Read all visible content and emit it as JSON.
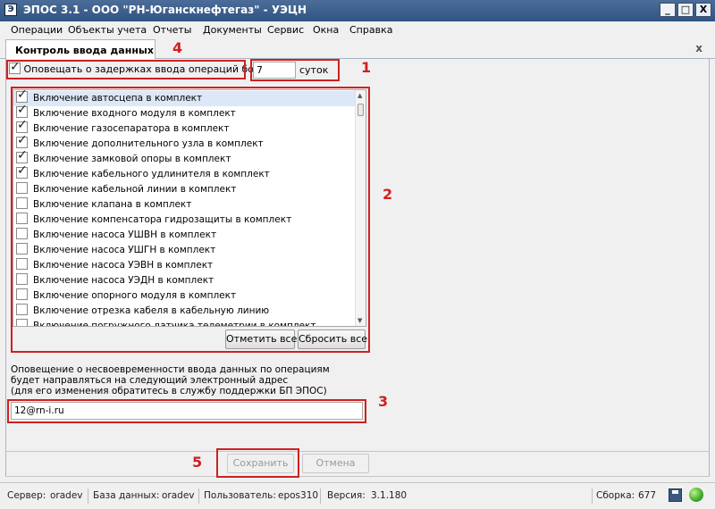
{
  "window": {
    "app_icon_glyph": "Э",
    "title": "ЭПОС 3.1 - ООО \"РН-Юганскнефтегаз\" - УЭЦН",
    "minimize": "_",
    "maximize": "□",
    "close": "X"
  },
  "menu": [
    "Операции",
    "Объекты учета",
    "Отчеты",
    "Документы",
    "Сервис",
    "Окна",
    "Справка"
  ],
  "tab": {
    "label": "Контроль ввода данных",
    "close": "x"
  },
  "notify": {
    "checked": true,
    "label": "Оповещать о задержках ввода операций более",
    "days_value": "7",
    "days_unit": "суток"
  },
  "operations": [
    {
      "label": "Включение автосцепа в комплект",
      "checked": true,
      "selected": true
    },
    {
      "label": "Включение входного модуля в комплект",
      "checked": true
    },
    {
      "label": "Включение газосепаратора в комплект",
      "checked": true
    },
    {
      "label": "Включение дополнительного узла в комплект",
      "checked": true
    },
    {
      "label": "Включение замковой опоры в комплект",
      "checked": true
    },
    {
      "label": "Включение кабельного удлинителя в комплект",
      "checked": true
    },
    {
      "label": "Включение кабельной линии в комплект",
      "checked": false
    },
    {
      "label": "Включение клапана в комплект",
      "checked": false
    },
    {
      "label": "Включение компенсатора гидрозащиты в комплект",
      "checked": false
    },
    {
      "label": "Включение насоса УШВН в комплект",
      "checked": false
    },
    {
      "label": "Включение насоса УШГН в комплект",
      "checked": false
    },
    {
      "label": "Включение насоса УЭВН в комплект",
      "checked": false
    },
    {
      "label": "Включение насоса УЭДН в комплект",
      "checked": false
    },
    {
      "label": "Включение опорного модуля в комплект",
      "checked": false
    },
    {
      "label": "Включение отрезка кабеля в кабельную линию",
      "checked": false
    },
    {
      "label": "Включение погружного датчика телеметрии в комплект",
      "checked": false
    }
  ],
  "buttons": {
    "check_all": "Отметить все",
    "reset_all": "Сбросить все",
    "save": "Сохранить",
    "cancel": "Отмена"
  },
  "info": {
    "line1": "Оповещение о несвоевременности ввода данных по операциям",
    "line2": "будет направляться на следующий электронный адрес",
    "line3": "(для его изменения обратитесь в службу поддержки БП ЭПОС)",
    "email": "12@rn-i.ru"
  },
  "annotations": [
    "1",
    "2",
    "3",
    "4",
    "5"
  ],
  "status": {
    "server_label": "Сервер:",
    "server": "oradev",
    "db_label": "База данных:",
    "db": "oradev",
    "user_label": "Пользователь:",
    "user": "epos310",
    "version_label": "Версия:",
    "version": "3.1.180",
    "build_label": "Сборка:",
    "build": "677"
  },
  "colors": {
    "annotation_red": "#d02020",
    "titlebar": "#2f5383",
    "status_led": "#3fa82a"
  },
  "icons": [
    "app-icon",
    "save-icon",
    "status-led-icon",
    "checkbox-icon",
    "scroll-up-icon",
    "scroll-down-icon"
  ]
}
